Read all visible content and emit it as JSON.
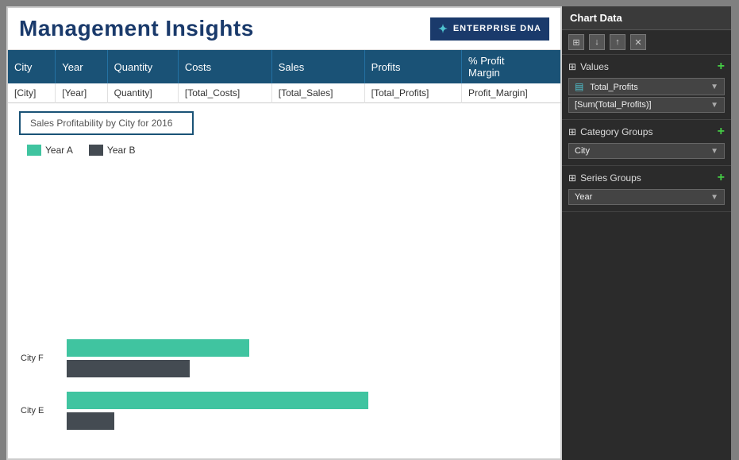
{
  "header": {
    "title": "Management Insights",
    "logo": {
      "brand": "ENTERPRISE DNA",
      "icon": "★"
    }
  },
  "table": {
    "columns": [
      "City",
      "Year",
      "Quantity",
      "Costs",
      "Sales",
      "Profits",
      "% Profit\nMargin"
    ],
    "rows": [
      [
        "[City]",
        "[Year]",
        "Quantity]",
        "[Total_Costs]",
        "[Total_Sales]",
        "[Total_Profits]",
        "Profit_Margin]"
      ]
    ]
  },
  "chart": {
    "title": "Sales Profitability by City for 2016",
    "legend": {
      "year_a": "Year A",
      "year_b": "Year B"
    },
    "bars": [
      {
        "city": "City F",
        "year_a_width": 230,
        "year_b_width": 155
      },
      {
        "city": "City E",
        "year_a_width": 380,
        "year_b_width": 60
      }
    ]
  },
  "right_panel": {
    "title": "Chart Data",
    "toolbar": {
      "buttons": [
        "▦",
        "↓",
        "↑",
        "✕"
      ]
    },
    "values_section": {
      "label": "Values",
      "fields": [
        {
          "name": "Total_Profits",
          "sub": "[Sum(Total_Profits)]"
        }
      ]
    },
    "category_groups_section": {
      "label": "Category Groups",
      "fields": [
        {
          "name": "City"
        }
      ]
    },
    "series_groups_section": {
      "label": "Series Groups",
      "fields": [
        {
          "name": "Year"
        }
      ]
    }
  }
}
